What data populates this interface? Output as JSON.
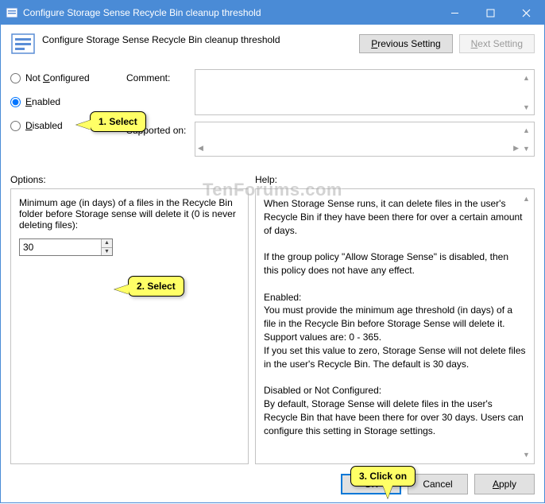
{
  "window": {
    "title": "Configure Storage Sense Recycle Bin cleanup threshold"
  },
  "heading": {
    "title": "Configure Storage Sense Recycle Bin cleanup threshold",
    "prev_btn": "Previous Setting",
    "next_btn": "Next Setting"
  },
  "state": {
    "not_configured": "Not Configured",
    "enabled": "Enabled",
    "disabled": "Disabled",
    "selected": "enabled"
  },
  "labels": {
    "comment": "Comment:",
    "supported": "Supported on:",
    "options": "Options:",
    "help": "Help:"
  },
  "options": {
    "min_age_label": "Minimum age (in days) of a files in the Recycle Bin folder before Storage sense will delete it (0 is never deleting files):",
    "min_age_value": "30"
  },
  "help": {
    "text": "When Storage Sense runs, it can delete files in the user's Recycle Bin if they have been there for over a certain amount of days.\n\nIf the group policy \"Allow Storage Sense\" is disabled, then this policy does not have any effect.\n\nEnabled:\nYou must provide the minimum age threshold (in days) of a file in the Recycle Bin before Storage Sense will delete it. Support values are: 0 - 365.\nIf you set this value to zero, Storage Sense will not delete files in the user's Recycle Bin. The default is 30 days.\n\nDisabled or Not Configured:\nBy default, Storage Sense will delete files in the user's Recycle Bin that have been there for over 30 days. Users can configure this setting in Storage settings."
  },
  "buttons": {
    "ok": "OK",
    "cancel": "Cancel",
    "apply": "Apply"
  },
  "callouts": {
    "c1": "1. Select",
    "c2": "2. Select",
    "c3": "3. Click on"
  },
  "watermark": "TenForums.com"
}
